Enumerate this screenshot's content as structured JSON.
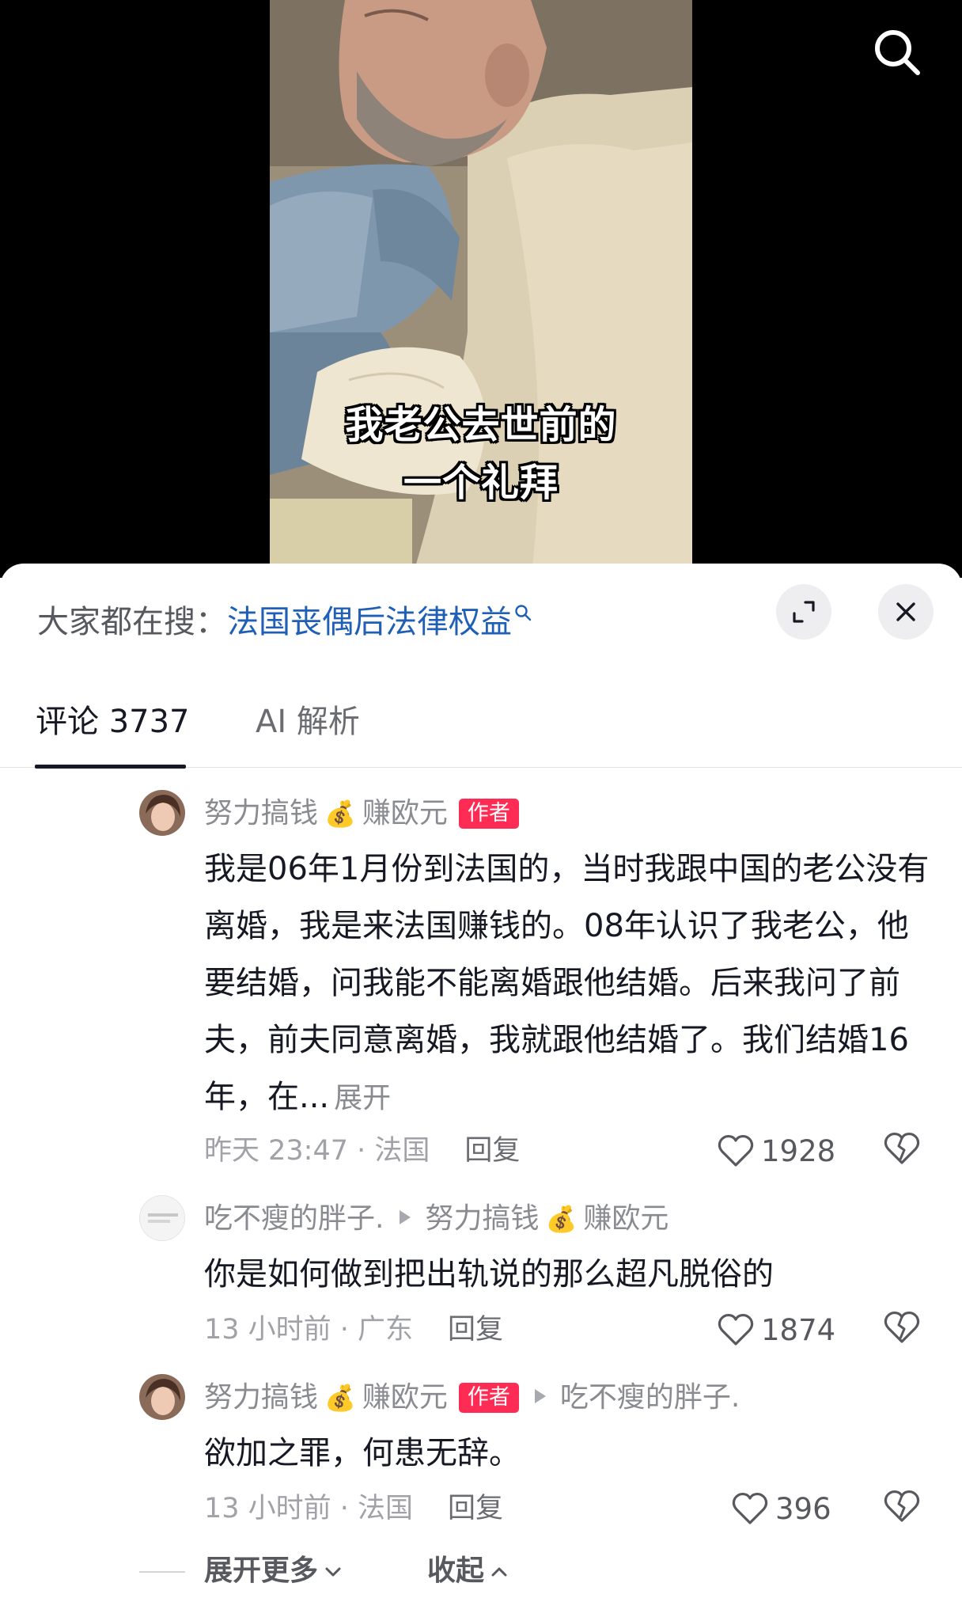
{
  "video": {
    "subtitle_line1": "我老公去世前的",
    "subtitle_line2": "一个礼拜",
    "search_icon": "search-icon"
  },
  "hot_search": {
    "prefix": "大家都在搜：",
    "query": "法国丧偶后法律权益"
  },
  "tabs": {
    "comments_label": "评论 3737",
    "ai_label": "AI 解析"
  },
  "comments": [
    {
      "user": "努力搞钱",
      "user_suffix": "赚欧元",
      "emoji": "💰",
      "badge": "作者",
      "text": "我是06年1月份到法国的，当时我跟中国的老公没有离婚，我是来法国赚钱的。08年认识了我老公，他要结婚，问我能不能离婚跟他结婚。后来我问了前夫，前夫同意离婚，我就跟他结婚了。我们结婚16年，在...",
      "more": "展开",
      "time_location": "昨天 23:47 · 法国",
      "reply": "回复",
      "likes": "1928"
    },
    {
      "user": "吃不瘦的胖子.",
      "reply_to": "努力搞钱",
      "reply_to_suffix": "赚欧元",
      "emoji": "💰",
      "text": "你是如何做到把出轨说的那么超凡脱俗的",
      "time_location": "13 小时前 · 广东",
      "reply": "回复",
      "likes": "1874"
    },
    {
      "user": "努力搞钱",
      "user_suffix": "赚欧元",
      "emoji": "💰",
      "badge": "作者",
      "reply_to": "吃不瘦的胖子.",
      "text": "欲加之罪，何患无辞。",
      "time_location": "13 小时前 · 法国",
      "reply": "回复",
      "likes": "396"
    }
  ],
  "footer": {
    "expand_more": "展开更多",
    "collapse": "收起"
  },
  "colors": {
    "link_blue": "#1f5fb5",
    "badge_red": "#fe2c55",
    "text_dark": "#161823",
    "text_gray": "#8a8b91"
  }
}
